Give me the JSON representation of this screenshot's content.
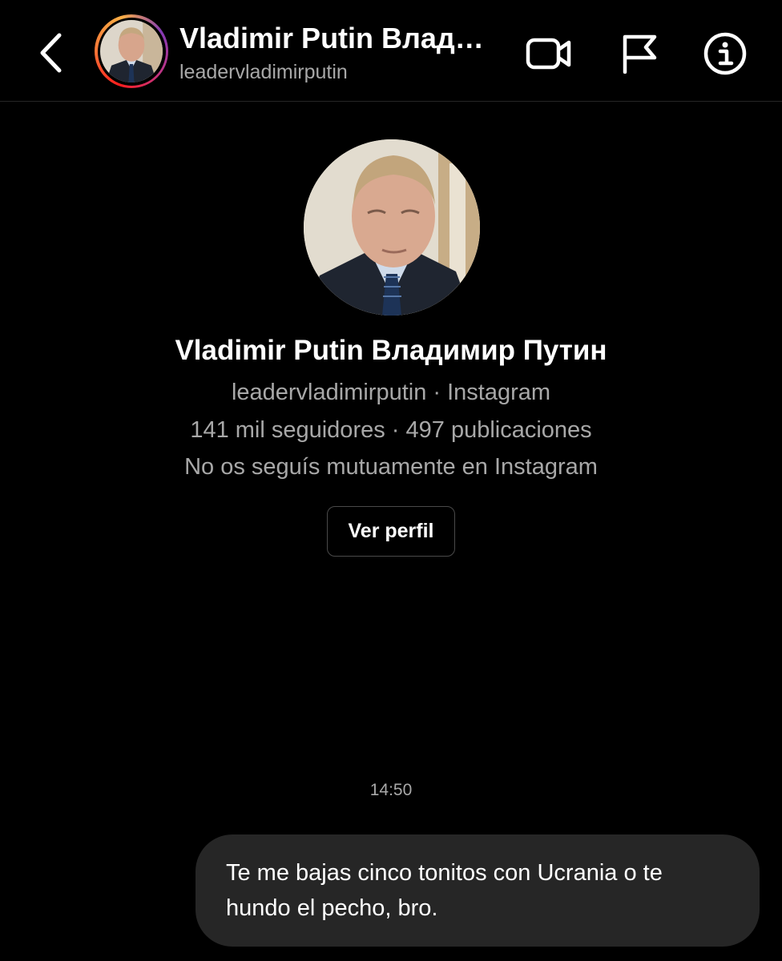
{
  "header": {
    "back_icon": "chevron-left-icon",
    "name": "Vladimir Putin  Владимир Путин",
    "username": "leadervladimirputin",
    "icons": [
      "video-camera-icon",
      "flag-icon",
      "info-icon"
    ]
  },
  "profile": {
    "name": "Vladimir Putin  Владимир Путин",
    "source_line": "leadervladimirputin · Instagram",
    "stats_line": "141 mil seguidores · 497 publicaciones",
    "mutual_line": "No os seguís mutuamente en Instagram",
    "view_profile_label": "Ver perfil"
  },
  "chat": {
    "timestamp": "14:50",
    "messages": [
      {
        "sender": "me",
        "text": "Te me bajas cinco tonitos con Ucrania o te hundo el pecho, bro."
      }
    ]
  },
  "colors": {
    "background": "#000000",
    "secondary_text": "#a8a8a8",
    "bubble": "#262626",
    "divider": "#262626"
  }
}
